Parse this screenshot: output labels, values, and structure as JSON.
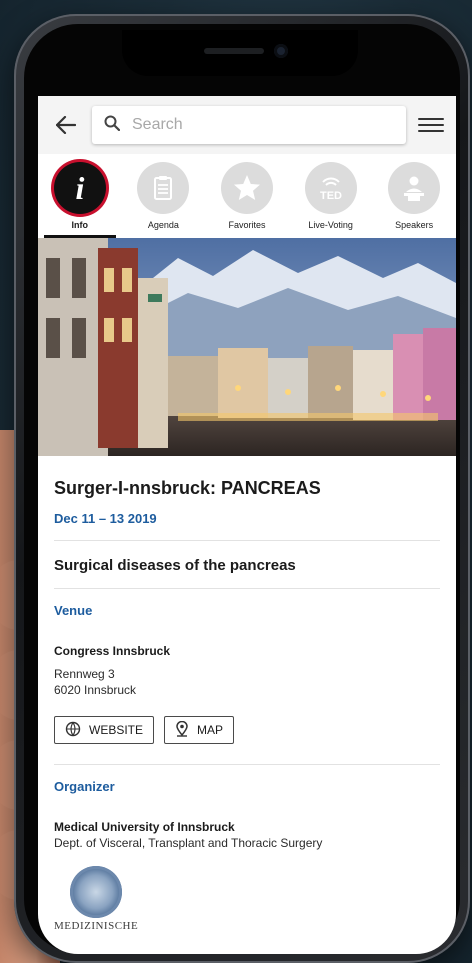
{
  "topbar": {
    "search_placeholder": "Search"
  },
  "tabs": [
    {
      "label": "Info",
      "icon": "info-icon",
      "active": true
    },
    {
      "label": "Agenda",
      "icon": "agenda-icon",
      "active": false
    },
    {
      "label": "Favorites",
      "icon": "star-icon",
      "active": false
    },
    {
      "label": "Live-Voting",
      "icon": "ted-icon",
      "active": false
    },
    {
      "label": "Speakers",
      "icon": "speaker-icon",
      "active": false
    }
  ],
  "ted_text": "TED",
  "event": {
    "title": "Surger-I-nnsbruck: PANCREAS",
    "date": "Dec 11 – 13 2019",
    "subtitle": "Surgical diseases of the pancreas"
  },
  "venue": {
    "heading": "Venue",
    "name": "Congress Innsbruck",
    "address_line1": "Rennweg 3",
    "address_line2": "6020 Innsbruck",
    "website_label": "WEBSITE",
    "map_label": "MAP"
  },
  "organizer": {
    "heading": "Organizer",
    "name": "Medical University of Innsbruck",
    "department": "Dept. of Visceral, Transplant and Thoracic Surgery",
    "logo_text": "MEDIZINISCHE"
  },
  "colors": {
    "accent_blue": "#1d5c9e",
    "active_ring": "#c8102e"
  }
}
